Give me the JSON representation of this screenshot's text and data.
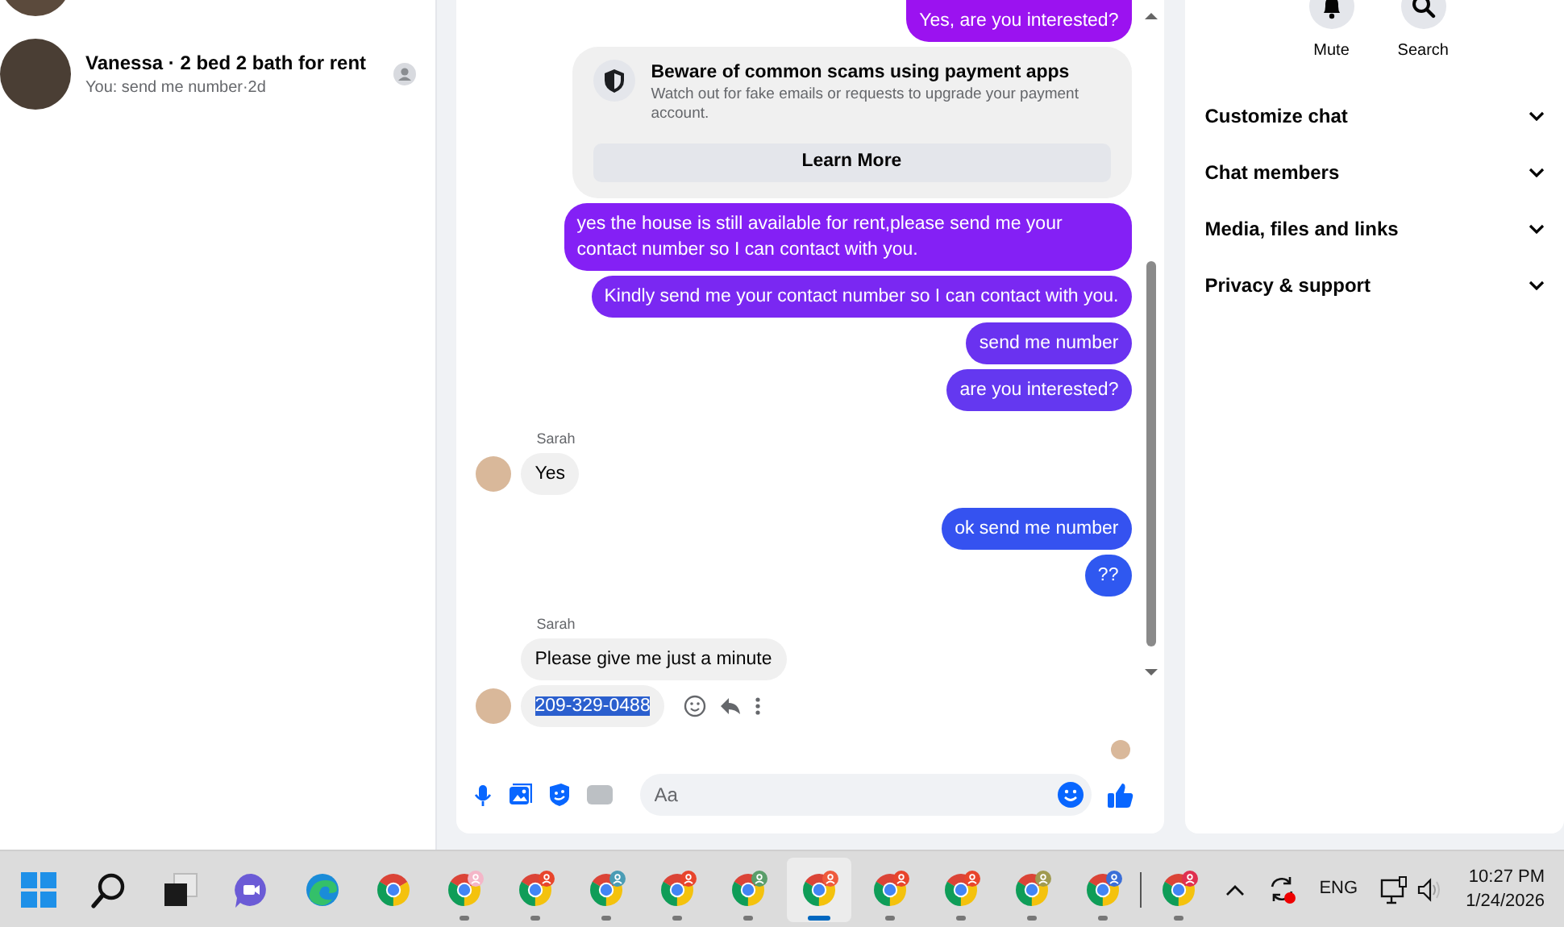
{
  "conversations": [
    {
      "title": "Vanessa · 2 bed 2 bath for rent",
      "preview": "You: send me number·2d"
    }
  ],
  "chat": {
    "messages": [
      {
        "kind": "outgoing",
        "text": "Yes, are you interested?",
        "color": "#9b12f0"
      },
      {
        "kind": "notice",
        "title": "Beware of common scams using payment apps",
        "text": "Watch out for fake emails or requests to upgrade your payment account.",
        "button": "Learn More"
      },
      {
        "kind": "outgoing",
        "text": "yes the house is still available for rent,please send me your contact number so I can contact with you.",
        "color": "#8420f5"
      },
      {
        "kind": "outgoing",
        "text": "Kindly send me your contact number so I can contact with you.",
        "color": "#7a28f2"
      },
      {
        "kind": "outgoing",
        "text": "send me number",
        "color": "#6a32f0"
      },
      {
        "kind": "outgoing",
        "text": "are you interested?",
        "color": "#6438f0"
      },
      {
        "kind": "sender",
        "text": "Sarah"
      },
      {
        "kind": "incoming",
        "text": "Yes",
        "avatar": true,
        "highlighted": false,
        "hovered": false
      },
      {
        "kind": "outgoing",
        "text": "ok send me number",
        "color": "#3552f0"
      },
      {
        "kind": "outgoing",
        "text": "??",
        "color": "#2f58f0"
      },
      {
        "kind": "sender",
        "text": "Sarah"
      },
      {
        "kind": "incoming",
        "text": "Please give me just a minute",
        "avatar": false,
        "highlighted": false,
        "hovered": false
      },
      {
        "kind": "incoming",
        "text": "209-329-0488",
        "avatar": true,
        "highlighted": true,
        "hovered": true
      },
      {
        "kind": "seen"
      }
    ],
    "composer": {
      "placeholder": "Aa"
    }
  },
  "details": {
    "actions": [
      {
        "kind": "mute",
        "label": "Mute"
      },
      {
        "kind": "search",
        "label": "Search"
      }
    ],
    "sections": [
      {
        "label": "Customize chat",
        "expanded": false
      },
      {
        "label": "Chat members",
        "expanded": false
      },
      {
        "label": "Media, files and links",
        "expanded": false
      },
      {
        "label": "Privacy & support",
        "expanded": false
      }
    ]
  },
  "taskbar": {
    "apps": [
      {
        "kind": "start",
        "running": false,
        "selected": false
      },
      {
        "kind": "search",
        "running": false,
        "selected": false
      },
      {
        "kind": "taskview",
        "running": false,
        "selected": false
      },
      {
        "kind": "meet",
        "running": false,
        "selected": false
      },
      {
        "kind": "edge",
        "running": false,
        "selected": false
      },
      {
        "kind": "chrome",
        "running": false,
        "selected": false
      },
      {
        "kind": "profile",
        "color": "#f4b6c8",
        "running": true,
        "selected": false
      },
      {
        "kind": "profile",
        "color": "#e8452c",
        "running": true,
        "selected": false
      },
      {
        "kind": "profile",
        "color": "#4a9cb5",
        "running": true,
        "selected": false
      },
      {
        "kind": "profile",
        "color": "#e8452c",
        "running": true,
        "selected": false
      },
      {
        "kind": "profile",
        "color": "#5a9e6a",
        "running": true,
        "selected": false
      },
      {
        "kind": "profile",
        "color": "#ef5a3c",
        "running": true,
        "selected": true
      },
      {
        "kind": "profile",
        "color": "#e8452c",
        "running": true,
        "selected": false
      },
      {
        "kind": "profile",
        "color": "#e8452c",
        "running": true,
        "selected": false
      },
      {
        "kind": "profile",
        "color": "#a09a50",
        "running": true,
        "selected": false
      },
      {
        "kind": "profile",
        "color": "#3a6ed8",
        "running": true,
        "selected": false
      },
      {
        "kind": "divider"
      },
      {
        "kind": "profile",
        "color": "#e03050",
        "running": true,
        "selected": false
      }
    ],
    "tray": {
      "language": "ENG",
      "time": "10:27 PM",
      "date": "1/24/2026"
    }
  }
}
